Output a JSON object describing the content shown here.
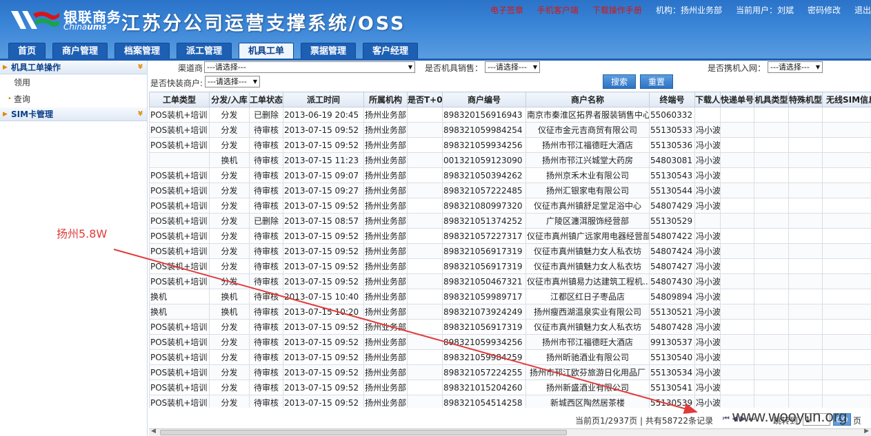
{
  "header": {
    "logo_cn": "银联商务",
    "logo_en_a": "China",
    "logo_en_b": "ums",
    "system_title": "江苏分公司运营支撑系统/OSS",
    "links": {
      "esign": "电子签章",
      "mobile_client": "手机客户端",
      "download_manual": "下载操作手册",
      "org_label": "机构：扬州业务部",
      "user_label": "当前用户：刘斌",
      "change_password": "密码修改",
      "logout": "退出"
    }
  },
  "nav": {
    "tabs": [
      "首页",
      "商户管理",
      "档案管理",
      "派工管理",
      "机具工单",
      "票据管理",
      "客户经理"
    ],
    "active": "机具工单"
  },
  "sidebar": {
    "group1": "机具工单操作",
    "items": [
      "领用",
      "查询"
    ],
    "group2": "SIM卡管理"
  },
  "filters": {
    "channel_label": "渠道商",
    "channel_value": "---请选择---",
    "is_sales_label": "是否机具销售：",
    "is_sales_value": "---请选择---",
    "carry_net_label": "是否携机入网：",
    "carry_net_value": "---请选择---",
    "quick_merchant_label": "是否快装商户:",
    "quick_merchant_value": "---请选择---",
    "search_button": "搜索",
    "reset_button": "重置"
  },
  "table": {
    "columns": [
      "工单类型",
      "分发/入库",
      "工单状态",
      "派工时间",
      "所属机构",
      "是否T+0",
      "商户编号",
      "商户名称",
      "终端号",
      "下载人",
      "快递单号",
      "机具类型",
      "特殊机型",
      "无线SIM信息"
    ],
    "rows": [
      [
        "POS装机+培训",
        "分发",
        "已删除",
        "2013-06-19 20:45",
        "扬州业务部",
        "",
        "898320156916943",
        "南京市秦淮区拓界者服装销售中心",
        "55060332",
        ""
      ],
      [
        "POS装机+培训",
        "分发",
        "待审核",
        "2013-07-15 09:52",
        "扬州业务部",
        "",
        "898321059984254",
        "仪征市金元吉商贸有限公司",
        "55130533",
        "冯小波"
      ],
      [
        "POS装机+培训",
        "分发",
        "待审核",
        "2013-07-15 09:52",
        "扬州业务部",
        "",
        "898321059934256",
        "扬州市邗江福德旺大酒店",
        "55130536",
        "冯小波"
      ],
      [
        "",
        "换机",
        "待审核",
        "2013-07-15 11:23",
        "扬州业务部",
        "",
        "001321059123090",
        "扬州市邗江兴城堂大药房",
        "54803081",
        "冯小波"
      ],
      [
        "POS装机+培训",
        "分发",
        "待审核",
        "2013-07-15 09:07",
        "扬州业务部",
        "",
        "898321050394262",
        "扬州京禾木业有限公司",
        "55130543",
        "冯小波"
      ],
      [
        "POS装机+培训",
        "分发",
        "待审核",
        "2013-07-15 09:27",
        "扬州业务部",
        "",
        "898321057222485",
        "扬州汇银家电有限公司",
        "55130544",
        "冯小波"
      ],
      [
        "POS装机+培训",
        "分发",
        "待审核",
        "2013-07-15 09:52",
        "扬州业务部",
        "",
        "898321080997320",
        "仪征市真州镇舒足堂足浴中心",
        "54807429",
        "冯小波"
      ],
      [
        "POS装机+培训",
        "分发",
        "已删除",
        "2013-07-15 08:57",
        "扬州业务部",
        "",
        "898321051374252",
        "广陵区瀍洱服饰经营部",
        "55130529",
        ""
      ],
      [
        "POS装机+培训",
        "分发",
        "待审核",
        "2013-07-15 09:52",
        "扬州业务部",
        "",
        "898321057227317",
        "仪征市真州镇广远家用电器经营部",
        "54807422",
        "冯小波"
      ],
      [
        "POS装机+培训",
        "分发",
        "待审核",
        "2013-07-15 09:52",
        "扬州业务部",
        "",
        "898321056917319",
        "仪征市真州镇魅力女人私衣坊",
        "54807424",
        "冯小波"
      ],
      [
        "POS装机+培训",
        "分发",
        "待审核",
        "2013-07-15 09:52",
        "扬州业务部",
        "",
        "898321056917319",
        "仪征市真州镇魅力女人私衣坊",
        "54807427",
        "冯小波"
      ],
      [
        "POS装机+培训",
        "分发",
        "待审核",
        "2013-07-15 09:52",
        "扬州业务部",
        "",
        "898321050467321",
        "仪征市真州镇易力达建筑工程机...",
        "54807430",
        "冯小波"
      ],
      [
        "换机",
        "换机",
        "待审核",
        "2013-07-15 10:40",
        "扬州业务部",
        "",
        "898321059989717",
        "江都区红日子枣品店",
        "54809894",
        "冯小波"
      ],
      [
        "换机",
        "换机",
        "待审核",
        "2013-07-15 10:20",
        "扬州业务部",
        "",
        "898321073924249",
        "扬州瘦西湖温泉实业有限公司",
        "55130521",
        "冯小波"
      ],
      [
        "POS装机+培训",
        "分发",
        "待审核",
        "2013-07-15 09:52",
        "扬州业务部",
        "",
        "898321056917319",
        "仪征市真州镇魅力女人私衣坊",
        "54807428",
        "冯小波"
      ],
      [
        "POS装机+培训",
        "分发",
        "待审核",
        "2013-07-15 09:52",
        "扬州业务部",
        "",
        "898321059934256",
        "扬州市邗江福德旺大酒店",
        "99130537",
        "冯小波"
      ],
      [
        "POS装机+培训",
        "分发",
        "待审核",
        "2013-07-15 09:52",
        "扬州业务部",
        "",
        "898321059984259",
        "扬州昕驰酒业有限公司",
        "55130540",
        "冯小波"
      ],
      [
        "POS装机+培训",
        "分发",
        "待审核",
        "2013-07-15 09:52",
        "扬州业务部",
        "",
        "898321057224255",
        "扬州市邗江欧芬旅游日化用品厂",
        "55130534",
        "冯小波"
      ],
      [
        "POS装机+培训",
        "分发",
        "待审核",
        "2013-07-15 09:52",
        "扬州业务部",
        "",
        "898321015204260",
        "扬州新盛酒业有限公司",
        "55130541",
        "冯小波"
      ],
      [
        "POS装机+培训",
        "分发",
        "待审核",
        "2013-07-15 09:52",
        "扬州业务部",
        "",
        "898321054514258",
        "新城西区陶然居茶楼",
        "55130539",
        "冯小波"
      ]
    ]
  },
  "pager": {
    "info": "当前页1/2937页 | 共有58722条记录",
    "goto_label": "跳转到",
    "page_value": "1",
    "go_button": "GO",
    "page_suffix": "页"
  },
  "annotation": {
    "text": "扬州5.8W",
    "color": "#e23a3a"
  },
  "watermark": "www.wooyun.org",
  "colors": {
    "header_blue": "#2a73c9",
    "link_red": "#d61515",
    "accent_orange": "#e08a00"
  }
}
